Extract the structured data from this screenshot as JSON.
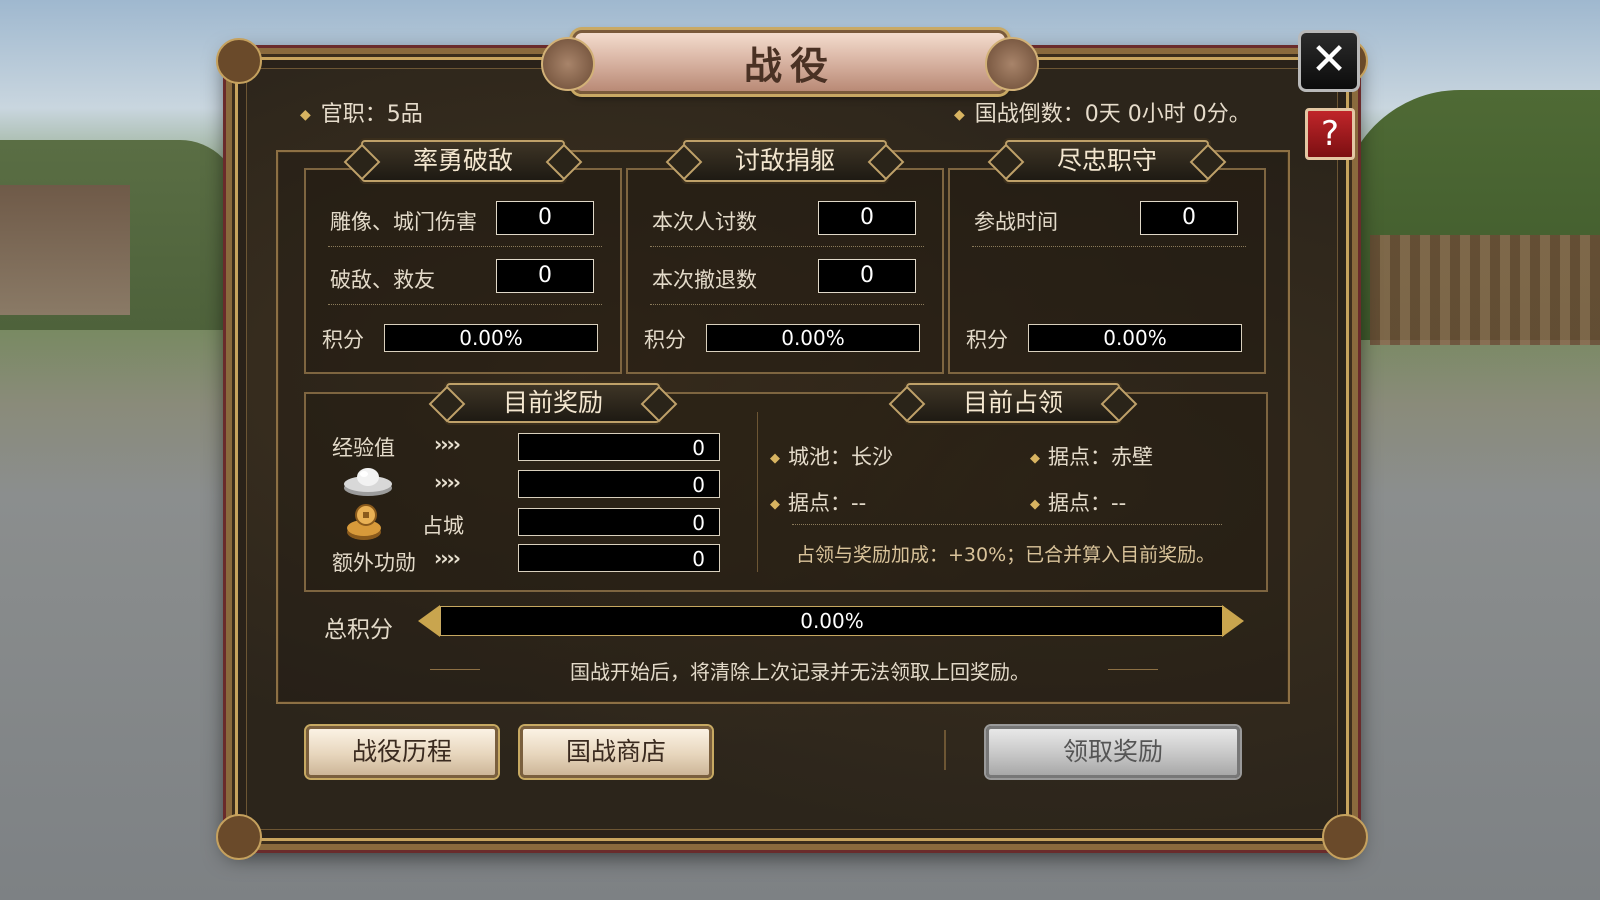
{
  "title": "战役",
  "header": {
    "rank": "官职：5品",
    "countdown": "国战倒数：0天 0小时 0分。"
  },
  "icons": {
    "close": "close-icon",
    "help": "help-icon",
    "ingot": "silver-ingot-icon",
    "coins": "copper-coins-icon"
  },
  "close_label": "✕",
  "help_label": "?",
  "sections": [
    {
      "title": "率勇破敌",
      "rows": [
        {
          "label": "雕像、城门伤害",
          "value": "0"
        },
        {
          "label": "破敌、救友",
          "value": "0"
        }
      ],
      "score_label": "积分",
      "score_value": "0.00%"
    },
    {
      "title": "讨敌捐躯",
      "rows": [
        {
          "label": "本次人讨数",
          "value": "0"
        },
        {
          "label": "本次撤退数",
          "value": "0"
        }
      ],
      "score_label": "积分",
      "score_value": "0.00%"
    },
    {
      "title": "尽忠职守",
      "rows": [
        {
          "label": "参战时间",
          "value": "0"
        }
      ],
      "score_label": "积分",
      "score_value": "0.00%"
    }
  ],
  "rewards": {
    "title": "目前奖励",
    "arrows": "››››",
    "items": [
      {
        "label": "经验值",
        "value": "0"
      },
      {
        "label": "",
        "value": "0"
      },
      {
        "label": "占城",
        "value": "0"
      },
      {
        "label": "额外功勋",
        "value": "0"
      }
    ]
  },
  "occupy": {
    "title": "目前占领",
    "city": "城池：长沙",
    "stronghold1": "据点：赤壁",
    "stronghold2": "据点：--",
    "stronghold3": "据点：--",
    "bonus": "占领与奖励加成：+30%；已合并算入目前奖励。"
  },
  "total": {
    "label": "总积分",
    "value": "0.00%"
  },
  "notice": "国战开始后，将清除上次记录并无法领取上回奖励。",
  "buttons": {
    "history": "战役历程",
    "shop": "国战商店",
    "claim": "领取奖励"
  },
  "colors": {
    "gold_frame": "#c8a45e",
    "panel_bg": "#2c251b",
    "help_red": "#c0262a"
  }
}
